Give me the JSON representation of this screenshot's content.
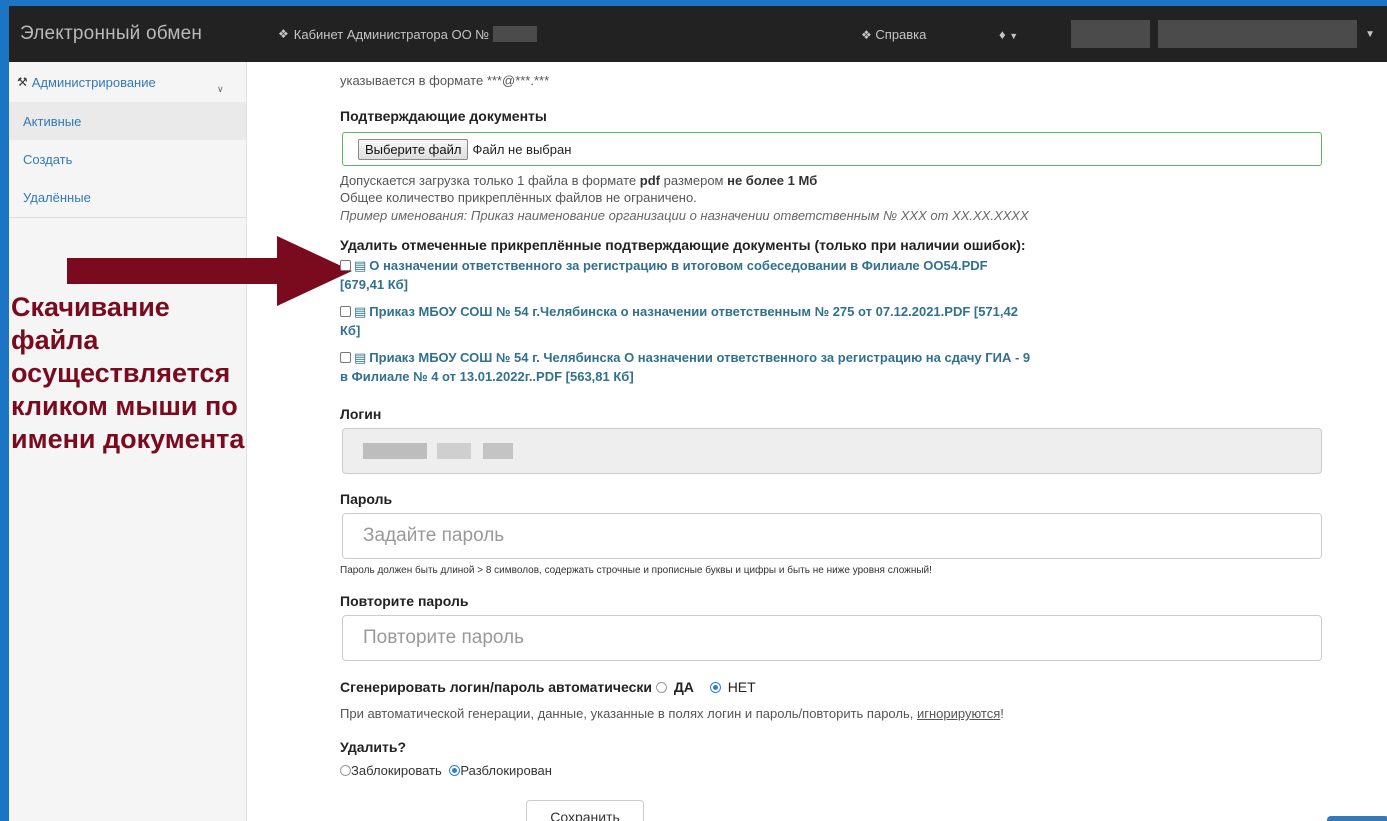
{
  "navbar": {
    "brand": "Электронный обмен",
    "cabinet_label": "Кабинет Администратора ОО №",
    "help_label": "Справка"
  },
  "sidebar": {
    "header": "Администрирование",
    "items": [
      {
        "label": "Активные",
        "active": true
      },
      {
        "label": "Создать",
        "active": false
      },
      {
        "label": "Удалённые",
        "active": false
      }
    ]
  },
  "annotation": {
    "lines": [
      "Скачивание",
      "файла",
      "осуществляется",
      "кликом мыши по",
      "имени документа"
    ],
    "color": "#7a0a1e"
  },
  "form": {
    "email_hint": "указывается в формате ***@***.***",
    "docs_label": "Подтверждающие документы",
    "file_button": "Выберите файл",
    "file_status": "Файл не выбран",
    "upload_hint_1_pre": "Допускается загрузка только 1 файла в формате",
    "upload_hint_1_pdf": "pdf",
    "upload_hint_1_mid": "размером",
    "upload_hint_1_limit": "не более 1 Мб",
    "upload_hint_2": "Общее количество прикреплённых файлов не ограничено.",
    "upload_hint_3": "Пример именования: Приказ наименование организации о назначении ответственным № XXX от XX.XX.XXXX",
    "delete_docs_label": "Удалить отмеченные прикреплённые подтверждающие документы (только при наличии ошибок):",
    "documents": [
      {
        "line1": "О назначении ответственного за регистрацию в итоговом собеседовании в Филиале ОО54.PDF",
        "line2": "[679,41 Кб]"
      },
      {
        "line1": "Приказ МБОУ СОШ № 54 г.Челябинска о назначении ответственным № 275 от 07.12.2021.PDF [571,42",
        "line2": "Кб]"
      },
      {
        "line1": "Приакз МБОУ СОШ № 54 г. Челябинска О назначении ответственного за регистрацию на сдачу ГИА - 9",
        "line2": "в Филиале № 4 от 13.01.2022г..PDF [563,81 Кб]"
      }
    ],
    "login_label": "Логин",
    "password_label": "Пароль",
    "password_placeholder": "Задайте пароль",
    "password_rule": "Пароль должен быть длиной > 8 символов, содержать строчные и прописные буквы и цифры и быть не ниже уровня сложный!",
    "repeat_label": "Повторите пароль",
    "repeat_placeholder": "Повторите пароль",
    "autogen_label": "Сгенерировать логин/пароль автоматически",
    "autogen_yes": "ДА",
    "autogen_no": "НЕТ",
    "autogen_selected": "НЕТ",
    "autogen_note_pre": "При автоматической генерации, данные, указанные в полях логин и пароль/повторить пароль,",
    "autogen_note_link": "игнорируются",
    "autogen_note_post": "!",
    "delete_label": "Удалить?",
    "lock_option": "Заблокировать",
    "unlock_option": "Разблокирован",
    "lock_selected": "Разблокирован",
    "save_button": "Сохранить"
  },
  "colors": {
    "navbar_bg": "#222222",
    "link": "#31708f",
    "accent": "#337ab7",
    "success_border": "#5cb85c",
    "frame": "#1c74c4"
  }
}
